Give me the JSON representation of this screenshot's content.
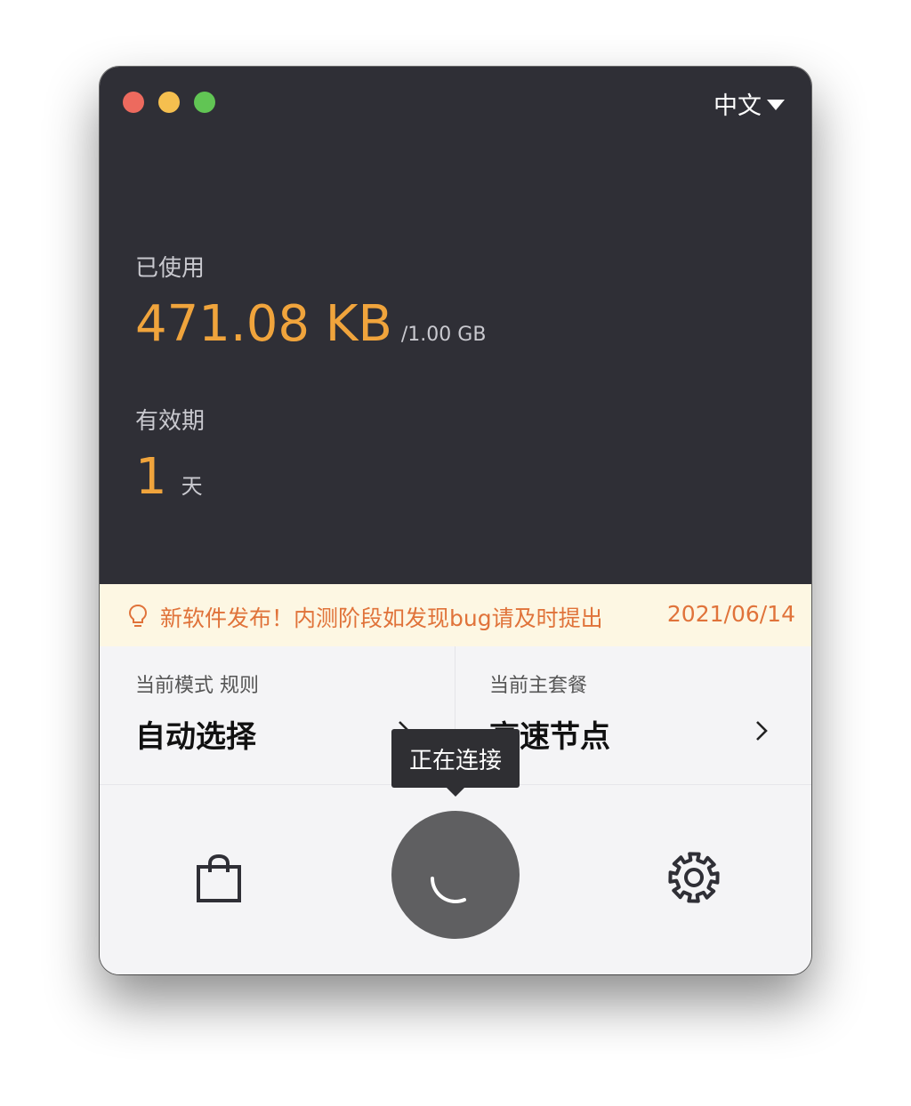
{
  "header": {
    "language": "中文"
  },
  "usage": {
    "label": "已使用",
    "used": "471.08 KB",
    "total": "/1.00 GB"
  },
  "validity": {
    "label": "有效期",
    "value": "1",
    "unit": "天"
  },
  "notice": {
    "icon": "lightbulb-icon",
    "message": "新软件发布！内测阶段如发现bug请及时提出",
    "date": "2021/06/14"
  },
  "mode": {
    "label": "当前模式 规则",
    "value": "自动选择"
  },
  "plan": {
    "label": "当前主套餐",
    "value": "高速节点"
  },
  "connect": {
    "tooltip": "正在连接",
    "state_icon": "spinner-icon"
  },
  "toolbar": {
    "left_icon": "shopping-bag-icon",
    "right_icon": "gear-icon"
  },
  "colors": {
    "accent": "#f0a43c",
    "panel": "#2f2f36",
    "notice_text": "#e0733a"
  }
}
